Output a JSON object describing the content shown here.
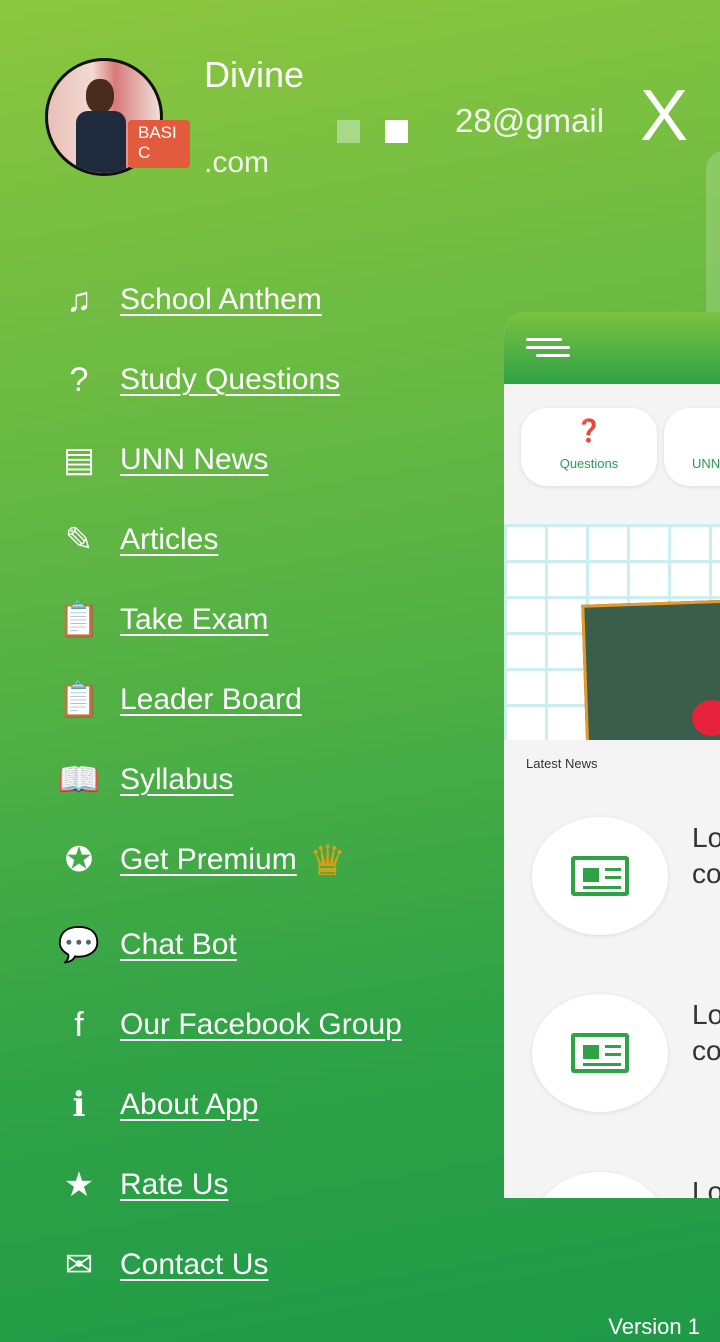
{
  "profile": {
    "name": "Divine",
    "badge": "BASI C",
    "email_part1": "28@gmail",
    "email_part2": ".com"
  },
  "close_label": "X",
  "menu": [
    {
      "label": "School Anthem",
      "icon": "music-note-icon",
      "glyph": "♫"
    },
    {
      "label": "Study Questions",
      "icon": "head-question-icon",
      "glyph": "?"
    },
    {
      "label": "UNN News",
      "icon": "newspaper-icon",
      "glyph": "▤"
    },
    {
      "label": "Articles",
      "icon": "article-icon",
      "glyph": "✎"
    },
    {
      "label": "Take Exam",
      "icon": "clipboard-icon",
      "glyph": "📋"
    },
    {
      "label": "Leader Board",
      "icon": "clipboard-list-icon",
      "glyph": "📋"
    },
    {
      "label": "Syllabus",
      "icon": "open-book-icon",
      "glyph": "📖"
    },
    {
      "label": "Get Premium",
      "icon": "premium-badge-icon",
      "glyph": "✪"
    },
    {
      "label": "Chat Bot",
      "icon": "chat-bubble-icon",
      "glyph": "💬"
    },
    {
      "label": "Our Facebook Group",
      "icon": "facebook-icon",
      "glyph": "f"
    },
    {
      "label": "About App",
      "icon": "info-icon",
      "glyph": "ℹ"
    },
    {
      "label": "Rate Us",
      "icon": "star-icon",
      "glyph": "★"
    },
    {
      "label": "Contact Us",
      "icon": "envelope-icon",
      "glyph": "✉"
    }
  ],
  "crown_glyph": "♛",
  "preview": {
    "chips": [
      "Questions",
      "UNN"
    ],
    "latest_news": "Latest News",
    "news_items": [
      {
        "line1": "Lo",
        "line2": "co"
      },
      {
        "line1": "Lo",
        "line2": "co"
      },
      {
        "line1": "Lo",
        "line2": ""
      }
    ]
  },
  "version": "Version 1",
  "colors": {
    "gradient_top": "#8cc63f",
    "gradient_bottom": "#1f9a48",
    "badge": "#e15b3c"
  }
}
